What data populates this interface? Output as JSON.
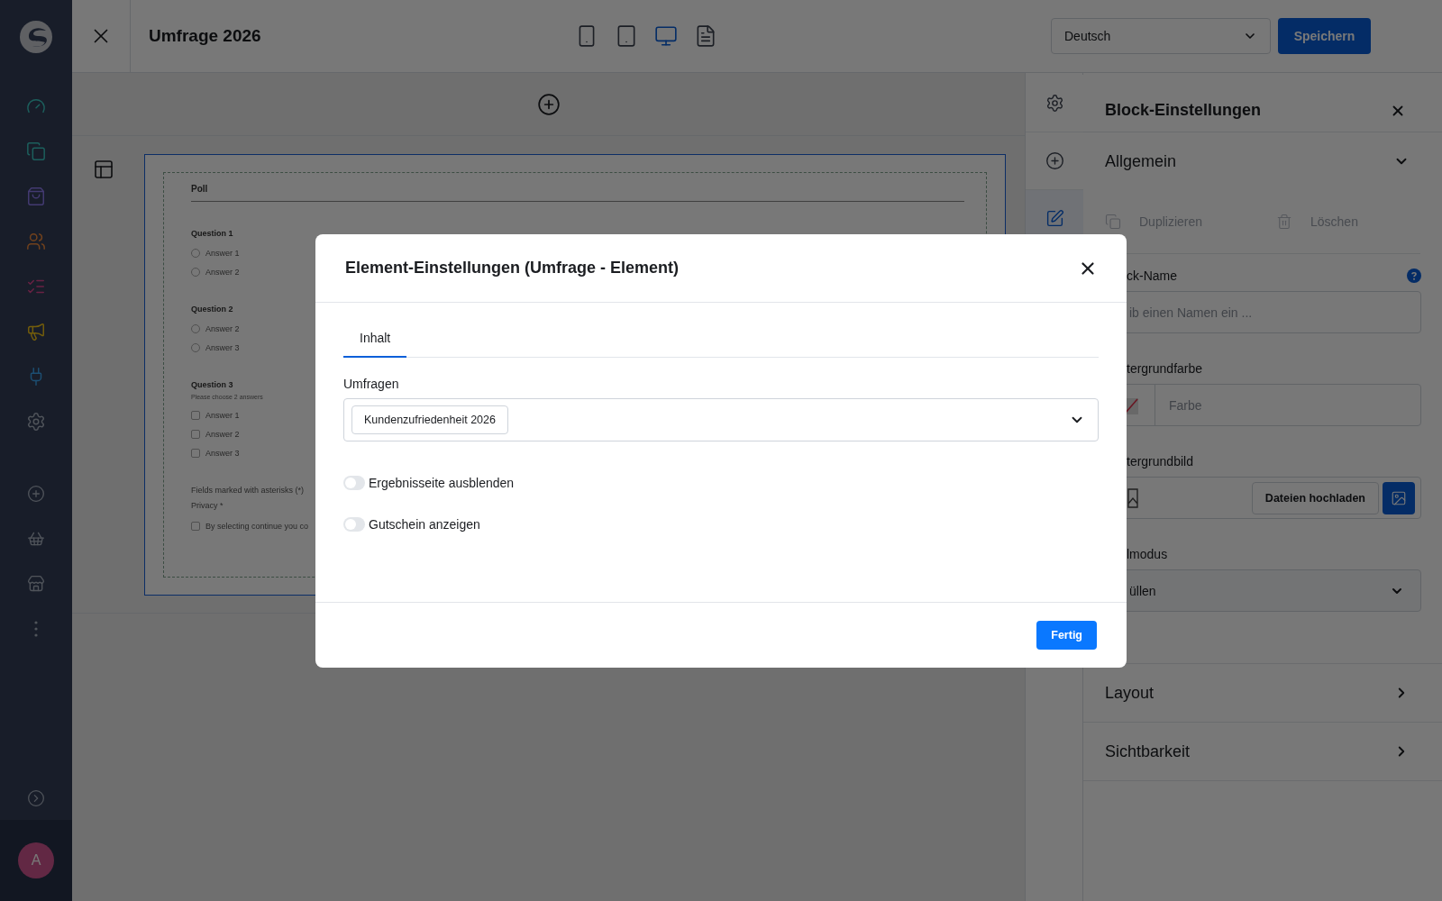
{
  "sidebar": {
    "items": [
      {
        "kind": "dashboard"
      },
      {
        "kind": "catalog"
      },
      {
        "kind": "orders"
      },
      {
        "kind": "customers"
      },
      {
        "kind": "content"
      },
      {
        "kind": "marketing"
      },
      {
        "kind": "extensions"
      },
      {
        "kind": "settings"
      }
    ],
    "tools": [
      {
        "kind": "add"
      },
      {
        "kind": "basket"
      },
      {
        "kind": "store"
      },
      {
        "kind": "more"
      }
    ],
    "avatar": "A"
  },
  "topbar": {
    "title": "Umfrage 2026",
    "devices": [
      {
        "kind": "phone",
        "selected": false
      },
      {
        "kind": "tablet",
        "selected": false
      },
      {
        "kind": "desktop",
        "selected": true
      },
      {
        "kind": "form",
        "selected": false
      }
    ],
    "language": "Deutsch",
    "save": "Speichern"
  },
  "preview": {
    "title": "Poll",
    "questions": [
      {
        "title": "Question 1",
        "kind": "radio",
        "answers": [
          {
            "label": "Answer 1",
            "checked": false
          },
          {
            "label": "Answer 2",
            "checked": false
          }
        ]
      },
      {
        "title": "Question 2",
        "kind": "radio",
        "answers": [
          {
            "label": "Answer 2",
            "checked": false
          },
          {
            "label": "Answer 3",
            "checked": false
          }
        ]
      },
      {
        "title": "Question 3",
        "kind": "checkbox",
        "hint": "Please choose 2 answers",
        "answers": [
          {
            "label": "Answer 1",
            "checked": false
          },
          {
            "label": "Answer 2",
            "checked": false
          },
          {
            "label": "Answer 3",
            "checked": false
          }
        ]
      }
    ],
    "required_note": "Fields marked with asterisks (*)",
    "privacy_label": "Privacy *",
    "privacy_text": "By selecting continue you co",
    "privacy_checked": false
  },
  "side_tools": [
    {
      "kind": "settings",
      "selected": false
    },
    {
      "kind": "add",
      "selected": false
    },
    {
      "kind": "edit",
      "selected": true
    }
  ],
  "panel": {
    "title": "Block-Einstellungen",
    "general": {
      "title": "Allgemein",
      "expanded": true
    },
    "actions": [
      {
        "kind": "duplicate",
        "label": "Duplizieren",
        "disabled": true
      },
      {
        "kind": "delete",
        "label": "Löschen",
        "disabled": true
      }
    ],
    "fields": [
      {
        "kind": "text",
        "label": "ck-Name",
        "placeholder": "ib einen Namen ein ...",
        "help": true
      },
      {
        "kind": "color",
        "label": "tergrundfarbe",
        "placeholder": "Farbe"
      },
      {
        "kind": "image",
        "label": "tergrundbild",
        "button": "Dateien hochladen"
      },
      {
        "kind": "select",
        "label": "lmodus",
        "value": "üllen"
      }
    ],
    "sections": [
      {
        "title": "Layout",
        "expanded": false
      },
      {
        "title": "Sichtbarkeit",
        "expanded": false
      }
    ]
  },
  "modal": {
    "title": "Element-Einstellungen (Umfrage - Element)",
    "tabs": [
      {
        "label": "Inhalt",
        "selected": true
      }
    ],
    "field_label": "Umfragen",
    "chip": "Kundenzufriedenheit 2026",
    "toggles": [
      {
        "label": "Ergebnisseite ausblenden",
        "on": false
      },
      {
        "label": "Gutschein anzeigen",
        "on": false
      }
    ],
    "done": "Fertig"
  }
}
